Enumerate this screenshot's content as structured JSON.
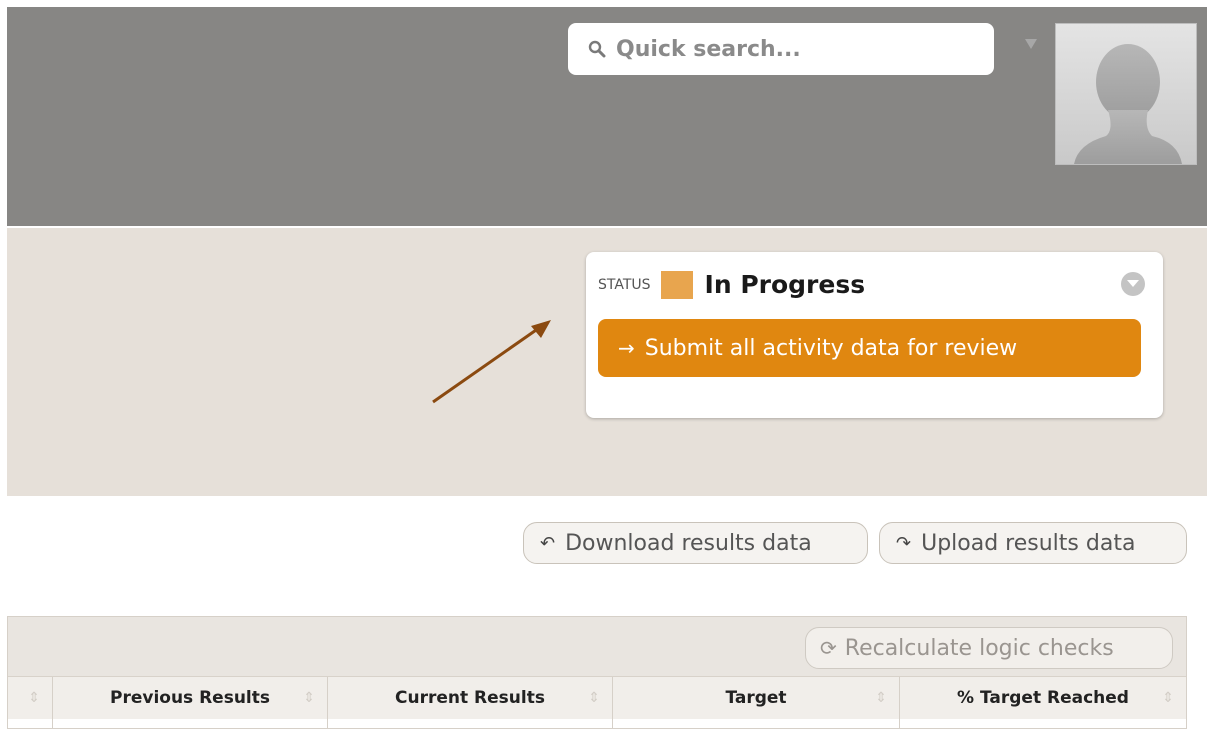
{
  "header": {
    "search": {
      "placeholder": "Quick search..."
    },
    "user_menu_icon": "caret-down-icon",
    "avatar_icon": "user-silhouette-icon"
  },
  "status_card": {
    "label": "STATUS",
    "value": "In Progress",
    "swatch_color": "#e8a54e",
    "toggle_icon": "chevron-down-icon",
    "submit_button": {
      "icon": "arrow-right-icon",
      "label": "Submit all activity data for review",
      "color": "#e08710"
    }
  },
  "annotation": {
    "arrow_color": "#8b4a10"
  },
  "actions": {
    "download_label": "Download results data",
    "upload_label": "Upload results data"
  },
  "results": {
    "recalculate_label": "Recalculate logic checks",
    "columns": [
      "Previous Results",
      "Current Results",
      "Target",
      "% Target Reached"
    ]
  }
}
